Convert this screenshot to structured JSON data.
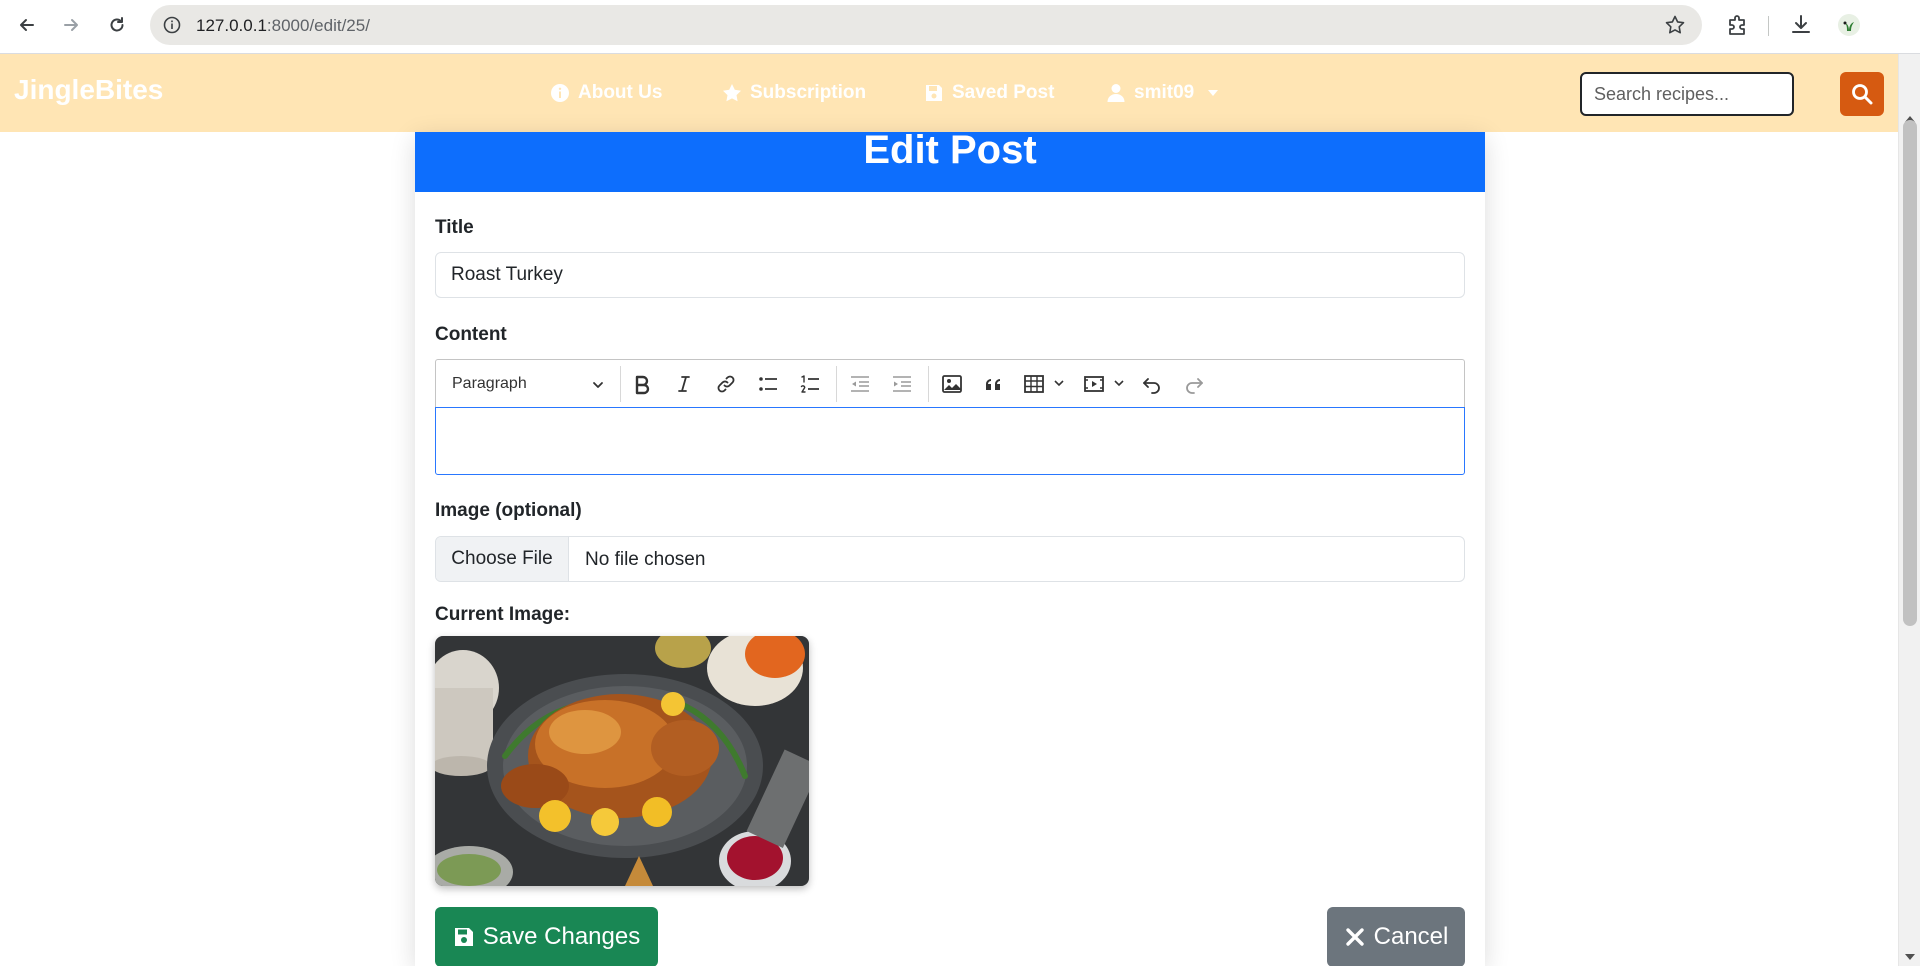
{
  "browser": {
    "url_host": "127.0.0.1",
    "url_path": ":8000/edit/25/"
  },
  "navbar": {
    "brand": "JingleBites",
    "links": [
      {
        "label": "About Us",
        "icon": "info-circle-icon"
      },
      {
        "label": "Subscription",
        "icon": "star-icon"
      },
      {
        "label": "Saved Post",
        "icon": "floppy-disk-icon"
      },
      {
        "label": "smit09",
        "icon": "user-icon"
      }
    ],
    "search_placeholder": "Search recipes..."
  },
  "form": {
    "heading": "Edit Post",
    "title_label": "Title",
    "title_value": "Roast Turkey",
    "content_label": "Content",
    "content_value": "",
    "toolbar": {
      "heading_select": "Paragraph",
      "buttons": [
        "bold",
        "italic",
        "link",
        "bulleted-list",
        "numbered-list",
        "outdent",
        "indent",
        "insert-image",
        "block-quote",
        "insert-table",
        "insert-media",
        "undo",
        "redo"
      ]
    },
    "image_label": "Image (optional)",
    "choose_file_label": "Choose File",
    "file_status": "No file chosen",
    "current_image_label": "Current Image:",
    "save_label": "Save Changes",
    "cancel_label": "Cancel"
  },
  "colors": {
    "navbar_bg": "#ffe5b4",
    "header_bg": "#0d6efd",
    "search_button": "#d65a11",
    "save_button": "#198754",
    "cancel_button": "#6c757d"
  }
}
